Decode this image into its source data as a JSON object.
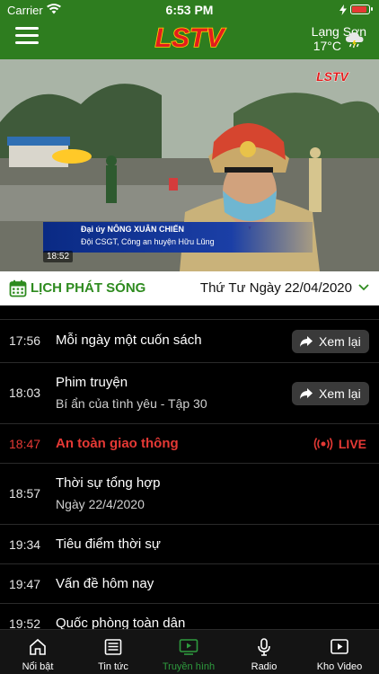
{
  "status_bar": {
    "carrier": "Carrier",
    "time": "6:53 PM"
  },
  "header": {
    "logo_text": "LSTV",
    "weather": {
      "city": "Lạng Sơn",
      "temp": "17°C",
      "icon": "rain-cloud-icon"
    }
  },
  "video": {
    "timestamp": "18:52",
    "caption_name": "Đại úy NÔNG XUÂN CHIẾN",
    "caption_role": "Đội CSGT, Công an huyện Hữu Lũng",
    "watermark": "LSTV"
  },
  "schedule": {
    "title": "LỊCH PHÁT SÓNG",
    "date": "Thứ Tư Ngày 22/04/2020",
    "replay_label": "Xem lại",
    "live_label": "LIVE",
    "items": [
      {
        "time": "",
        "program": "",
        "subtitle": "",
        "action": ""
      },
      {
        "time": "17:56",
        "program": "Mỗi ngày một cuốn sách",
        "subtitle": "",
        "action": "replay"
      },
      {
        "time": "18:03",
        "program": "Phim truyện",
        "subtitle": "Bí ẩn của tình yêu - Tập 30",
        "action": "replay"
      },
      {
        "time": "18:47",
        "program": "An toàn giao thông",
        "subtitle": "",
        "action": "live"
      },
      {
        "time": "18:57",
        "program": "Thời sự tổng hợp",
        "subtitle": "Ngày 22/4/2020",
        "action": ""
      },
      {
        "time": "19:34",
        "program": "Tiêu điểm thời sự",
        "subtitle": "",
        "action": ""
      },
      {
        "time": "19:47",
        "program": "Vấn đề hôm nay",
        "subtitle": "",
        "action": ""
      },
      {
        "time": "19:52",
        "program": "Quốc phòng toàn dân",
        "subtitle": "",
        "action": ""
      }
    ]
  },
  "tabs": [
    {
      "label": "Nổi bật",
      "icon": "home-icon",
      "active": false
    },
    {
      "label": "Tin tức",
      "icon": "newspaper-icon",
      "active": false
    },
    {
      "label": "Truyền hình",
      "icon": "tv-play-icon",
      "active": true
    },
    {
      "label": "Radio",
      "icon": "microphone-icon",
      "active": false
    },
    {
      "label": "Kho Video",
      "icon": "video-library-icon",
      "active": false
    }
  ],
  "colors": {
    "brand_green": "#2e7d1f",
    "live_red": "#e53935",
    "active_tab": "#2e9b3e"
  }
}
